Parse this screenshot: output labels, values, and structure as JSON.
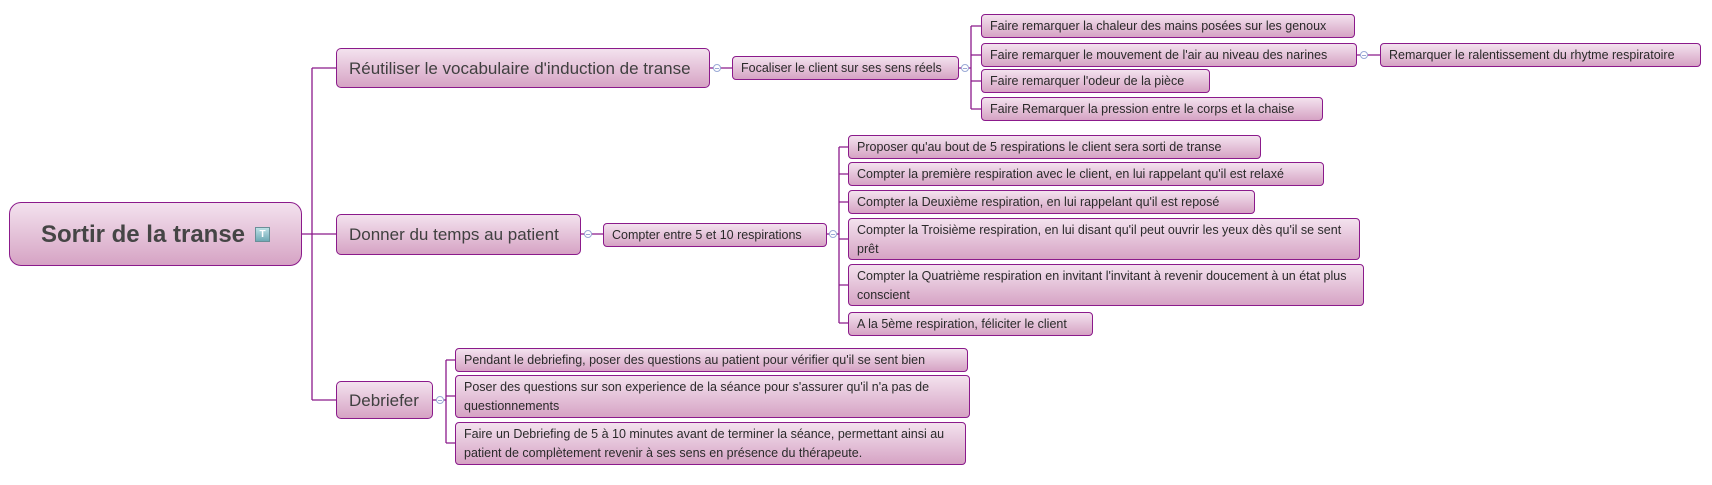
{
  "root": {
    "label": "Sortir de la transe",
    "icon": "text-note-icon"
  },
  "branches": [
    {
      "label": "Réutiliser le vocabulaire d'induction de transe",
      "child": {
        "label": "Focaliser le client sur ses sens réels",
        "children": [
          {
            "label": "Faire remarquer la chaleur des mains posées sur les genoux"
          },
          {
            "label": "Faire remarquer le mouvement de l'air au niveau des narines",
            "child": {
              "label": "Remarquer le ralentissement du rhytme respiratoire"
            }
          },
          {
            "label": "Faire remarquer l'odeur de la pièce"
          },
          {
            "label": "Faire Remarquer la pression entre le corps et la chaise"
          }
        ]
      }
    },
    {
      "label": "Donner du temps au patient",
      "child": {
        "label": "Compter entre 5 et 10 respirations",
        "children": [
          {
            "label": "Proposer qu'au bout de 5 respirations le client sera sorti de transe"
          },
          {
            "label": "Compter la première respiration avec le client, en lui rappelant qu'il est relaxé"
          },
          {
            "label": "Compter la Deuxième respiration, en lui rappelant qu'il est reposé"
          },
          {
            "label": "Compter la Troisième respiration, en lui disant qu'il peut ouvrir les yeux dès qu'il se sent prêt"
          },
          {
            "label": "Compter la Quatrième respiration en invitant l'invitant à revenir doucement à un état plus conscient"
          },
          {
            "label": "A la 5ème respiration, féliciter le client"
          }
        ]
      }
    },
    {
      "label": "Debriefer",
      "children": [
        {
          "label": "Pendant le debriefing, poser des questions au patient pour vérifier qu'il se sent bien"
        },
        {
          "label": "Poser des questions sur son experience de la séance pour s'assurer qu'il n'a pas de questionnements"
        },
        {
          "label": "Faire un Debriefing de 5 à 10 minutes avant de terminer la séance, permettant ainsi au patient de complètement revenir à ses sens en présence du thérapeute."
        }
      ]
    }
  ],
  "colors": {
    "border": "#8b1a8b",
    "fill_top": "#f3e2ee",
    "fill_bottom": "#d6a3c4",
    "connector": "#8b1a8b"
  }
}
